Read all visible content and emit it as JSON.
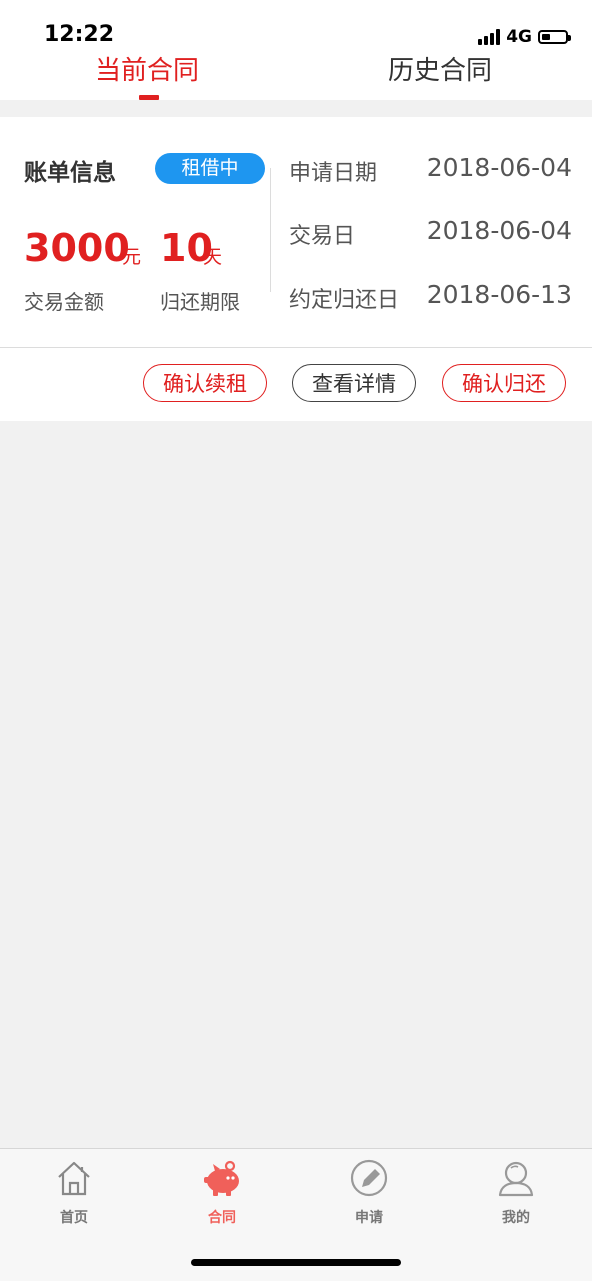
{
  "status_bar": {
    "time": "12:22",
    "network": "4G",
    "battery_level": 0.35
  },
  "tabs": [
    {
      "label": "当前合同",
      "active": true
    },
    {
      "label": "历史合同",
      "active": false
    }
  ],
  "bill": {
    "title": "账单信息",
    "status": "租借中",
    "amount": "3000",
    "amount_unit": "元",
    "amount_label": "交易金额",
    "term": "10",
    "term_unit": "天",
    "term_label": "归还期限",
    "info": [
      {
        "label": "申请日期",
        "value": "2018-06-04"
      },
      {
        "label": "交易日",
        "value": "2018-06-04"
      },
      {
        "label": "约定归还日",
        "value": "2018-06-13"
      }
    ]
  },
  "actions": {
    "renew": "确认续租",
    "detail": "查看详情",
    "return": "确认归还"
  },
  "nav": [
    {
      "label": "首页",
      "icon": "home-icon"
    },
    {
      "label": "合同",
      "icon": "piggy-bank-icon",
      "active": true
    },
    {
      "label": "申请",
      "icon": "pencil-icon"
    },
    {
      "label": "我的",
      "icon": "user-icon"
    }
  ],
  "colors": {
    "accent": "#e02020",
    "badge": "#1e96f0",
    "nav_active": "#f0605a"
  }
}
